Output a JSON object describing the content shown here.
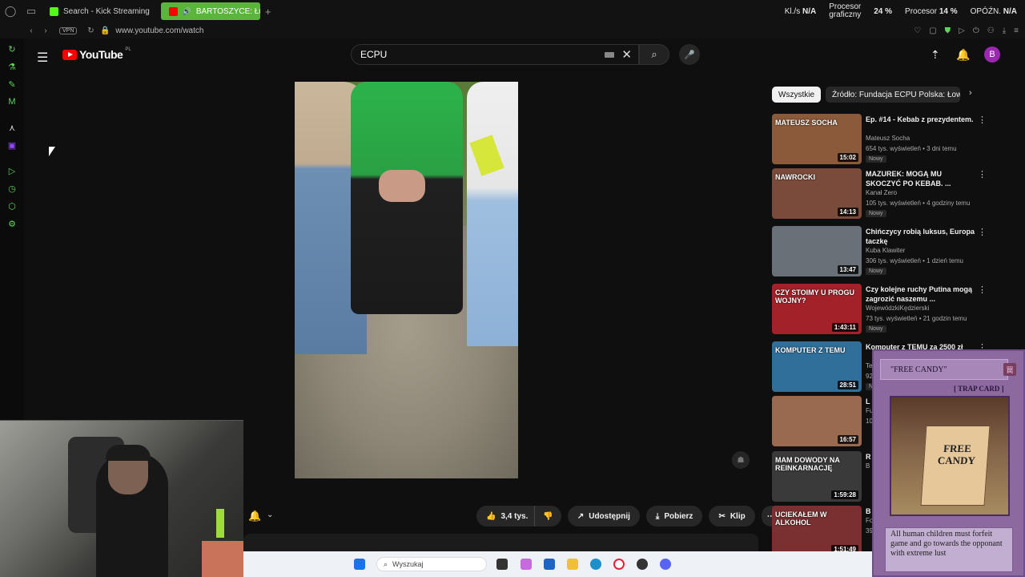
{
  "browser": {
    "tabs": [
      {
        "label": "Search - Kick Streaming",
        "active": false
      },
      {
        "label": "BARTOSZYCE: Łukas",
        "active": true
      }
    ],
    "url": "www.youtube.com/watch",
    "vpn_label": "VPN"
  },
  "sys": {
    "kbs_label": "Kl./s",
    "kbs_value": "N/A",
    "gpu_line1": "Procesor",
    "gpu_line2": "graficzny",
    "gpu_value": "24 %",
    "cpu_label": "Procesor",
    "cpu_value": "14 %",
    "delay_label": "OPÓŹN.",
    "delay_value": "N/A"
  },
  "youtube": {
    "logo_text": "YouTube",
    "region": "PL",
    "search_value": "ECPU",
    "avatar_letter": "B"
  },
  "actions": {
    "likes": "3,4 tys.",
    "share": "Udostępnij",
    "download": "Pobierz",
    "clip": "Klip"
  },
  "chips": [
    {
      "label": "Wszystkie",
      "selected": true
    },
    {
      "label": "Źródło: Fundacja ECPU Polska: Łowcy",
      "selected": false
    }
  ],
  "recommendations": [
    {
      "title": "Ep. #14 - Kebab z prezydentem.",
      "channel": "Mateusz Socha",
      "meta": "654 tys. wyświetleń • 3 dni temu",
      "badge": "Nowy",
      "duration": "15:02",
      "thumb_text": "MATEUSZ SOCHA",
      "thumb_color": "#8a5a3a"
    },
    {
      "title": "MAZUREK: MOGĄ MU SKOCZYĆ PO KEBAB. ...",
      "channel": "Kanał Zero",
      "meta": "105 tys. wyświetleń • 4 godziny temu",
      "badge": "Nowy",
      "duration": "14:13",
      "thumb_text": "NAWROCKI",
      "thumb_color": "#7a4a3a"
    },
    {
      "title": "Chińczycy robią luksus, Europa taczkę",
      "channel": "Kuba Klawiter",
      "meta": "306 tys. wyświetleń • 1 dzień temu",
      "badge": "Nowy",
      "duration": "13:47",
      "thumb_text": "",
      "thumb_color": "#6a7078"
    },
    {
      "title": "Czy kolejne ruchy Putina mogą zagrozić naszemu ...",
      "channel": "WojewódzkiKędzierski",
      "meta": "73 tys. wyświetleń • 21 godzin temu",
      "badge": "Nowy",
      "duration": "1:43:11",
      "thumb_text": "CZY STOIMY U PROGU WOJNY?",
      "thumb_color": "#a3222a"
    },
    {
      "title": "Komputer z TEMU za 2500 zł",
      "channel": "Te",
      "meta": "92",
      "badge": "N",
      "duration": "28:51",
      "thumb_text": "KOMPUTER Z TEMU",
      "thumb_color": "#2f6f9a"
    },
    {
      "title": "L D",
      "channel": "Fu",
      "meta": "10",
      "badge": "",
      "duration": "16:57",
      "thumb_text": "",
      "thumb_color": "#9a6a50"
    },
    {
      "title": "R re",
      "channel": "B",
      "meta": "",
      "badge": "",
      "duration": "1:59:28",
      "thumb_text": "MAM DOWODY NA REINKARNACJĘ",
      "thumb_color": "#3a3a3a"
    },
    {
      "title": "B W",
      "channel": "Fo",
      "meta": "39",
      "badge": "",
      "duration": "1:51:49",
      "thumb_text": "UCIEKAŁEM W ALKOHOL",
      "thumb_color": "#7a3030"
    }
  ],
  "card": {
    "name": "\"FREE CANDY\"",
    "type": "[ TRAP CARD ]",
    "art_text": "FREE CANDY",
    "description": "All human children must forfeit game and go towards the opponant with extreme lust"
  },
  "taskbar": {
    "search_placeholder": "Wyszukaj"
  }
}
